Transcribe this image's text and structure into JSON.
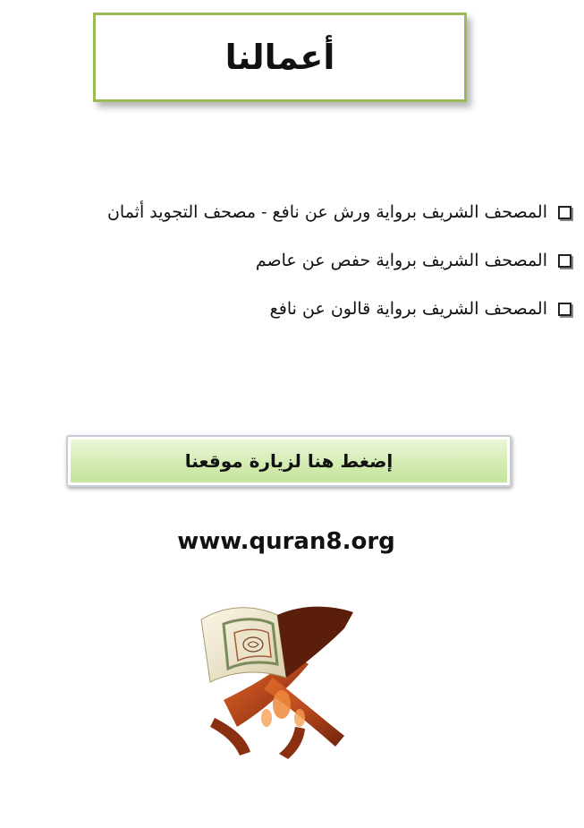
{
  "header": {
    "title": "أعمالنا"
  },
  "works": [
    {
      "label": "المصحف الشريف برواية ورش عن نافع - مصحف التجويد أثمان"
    },
    {
      "label": "المصحف الشريف برواية حفص عن عاصم"
    },
    {
      "label": "المصحف الشريف برواية قالون عن نافع"
    }
  ],
  "visit_button": {
    "label": "إضغط هنا لزيارة موقعنا"
  },
  "site": {
    "url": "www.quran8.org"
  },
  "colors": {
    "title_border": "#9bbb59",
    "button_green": "#c3e39a",
    "wood": "#b5471c"
  },
  "icons": {
    "list_marker": "checkbox-icon",
    "illustration": "quran-on-stand-icon"
  }
}
